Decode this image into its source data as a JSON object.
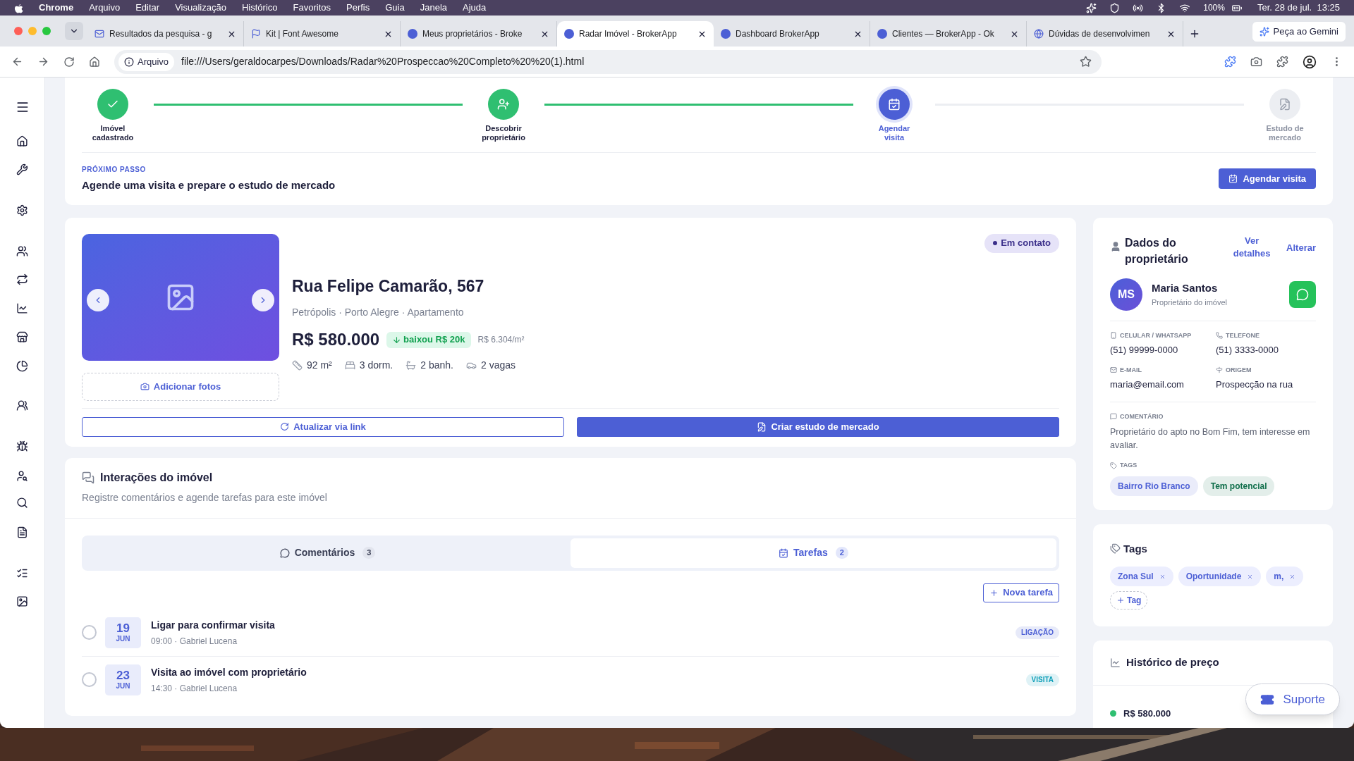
{
  "menu_bar": {
    "app": "Chrome",
    "items": [
      "Arquivo",
      "Editar",
      "Visualização",
      "Histórico",
      "Favoritos",
      "Perfis",
      "Guia",
      "Janela",
      "Ajuda"
    ],
    "battery": "100%",
    "clock": "Ter. 28 de jul.  13:25"
  },
  "browser": {
    "tabs": [
      {
        "title": "Resultados da pesquisa - g",
        "selected": false
      },
      {
        "title": "Kit | Font Awesome",
        "selected": false
      },
      {
        "title": "Meus proprietários - Broke",
        "selected": false
      },
      {
        "title": "Radar Imóvel - BrokerApp",
        "selected": true
      },
      {
        "title": "Dashboard BrokerApp",
        "selected": false
      },
      {
        "title": "Clientes — BrokerApp - Ok",
        "selected": false
      },
      {
        "title": "Dúvidas de desenvolvimen",
        "selected": false
      }
    ],
    "gemini_button": "Peça ao Gemini",
    "site_label": "Arquivo",
    "url": "file:///Users/geraldocarpes/Downloads/Radar%20Prospeccao%20Completo%20%20(1).html"
  },
  "stepper": {
    "steps": [
      {
        "label": "Imóvel cadastrado",
        "kind": "registered",
        "done": true,
        "current": false
      },
      {
        "label": "Descobrir proprietário",
        "kind": "owner",
        "done": true,
        "current": false
      },
      {
        "label": "Agendar visita",
        "kind": "visit",
        "done": false,
        "current": true
      },
      {
        "label": "Estudo de mercado",
        "kind": "study",
        "done": false,
        "current": false
      }
    ],
    "next_step": {
      "eyebrow": "PRÓXIMO PASSO",
      "title": "Agende uma visita e prepare o estudo de mercado",
      "button": "Agendar visita"
    }
  },
  "property": {
    "status_badge": "Em contato",
    "title": "Rua Felipe Camarão, 567",
    "subtitle": "Petrópolis · Porto Alegre · Apartamento",
    "price": "R$ 580.000",
    "price_change": "baixou R$ 20k",
    "price_per_m2": "R$ 6.304/m²",
    "features": [
      {
        "kind": "area",
        "text": "92 m²"
      },
      {
        "kind": "bedrooms",
        "text": "3 dorm."
      },
      {
        "kind": "bathrooms",
        "text": "2 banh."
      },
      {
        "kind": "parking",
        "text": "2 vagas"
      }
    ],
    "add_photos": "Adicionar fotos",
    "update_button": "Atualizar via link",
    "create_button": "Criar estudo de mercado"
  },
  "interactions": {
    "title": "Interações do imóvel",
    "subtitle": "Registre comentários e agende tarefas para este imóvel",
    "tabs": [
      {
        "label": "Comentários",
        "count": "3",
        "kind": "comments",
        "selected": false
      },
      {
        "label": "Tarefas",
        "count": "2",
        "kind": "tasks",
        "selected": true
      }
    ],
    "new_task": "Nova tarefa",
    "tasks": [
      {
        "day": "19",
        "month": "JUN",
        "title": "Ligar para confirmar visita",
        "meta": "09:00 · Gabriel Lucena",
        "tag": "LIGAÇÃO",
        "color": "#4c5fd5",
        "checked": false
      },
      {
        "day": "23",
        "month": "JUN",
        "title": "Visita ao imóvel com proprietário",
        "meta": "14:30 · Gabriel Lucena",
        "tag": "VISITA",
        "color": "#0e9fb8",
        "checked": false
      }
    ]
  },
  "owner": {
    "title": "Dados do proprietário",
    "details_link": "Ver detalhes",
    "edit_link": "Alterar",
    "initials": "MS",
    "name": "Maria Santos",
    "role": "Proprietário do imóvel",
    "fields": [
      {
        "kind": "mobile",
        "label": "CELULAR / WHATSAPP",
        "value": "(51) 99999-0000"
      },
      {
        "kind": "phone",
        "label": "TELEFONE",
        "value": "(51) 3333-0000"
      },
      {
        "kind": "email",
        "label": "E-MAIL",
        "value": "maria@email.com"
      },
      {
        "kind": "origin",
        "label": "ORIGEM",
        "value": "Prospecção na rua"
      }
    ],
    "comment_label": "COMENTÁRIO",
    "comment": "Proprietário do apto no Bom Fim, tem interesse em avaliar.",
    "tags_label": "TAGS",
    "tags": [
      {
        "text": "Bairro Rio Branco",
        "color": "#4c5fd5"
      },
      {
        "text": "Tem potencial",
        "color": "#0f6e4a"
      }
    ]
  },
  "tags_card": {
    "title": "Tags",
    "tags": [
      "Zona Sul",
      "Oportunidade",
      "m,"
    ],
    "add": "Tag"
  },
  "price_history": {
    "title": "Histórico de preço",
    "entries": [
      {
        "price": "R$ 580.000"
      }
    ]
  },
  "support_button": "Suporte"
}
